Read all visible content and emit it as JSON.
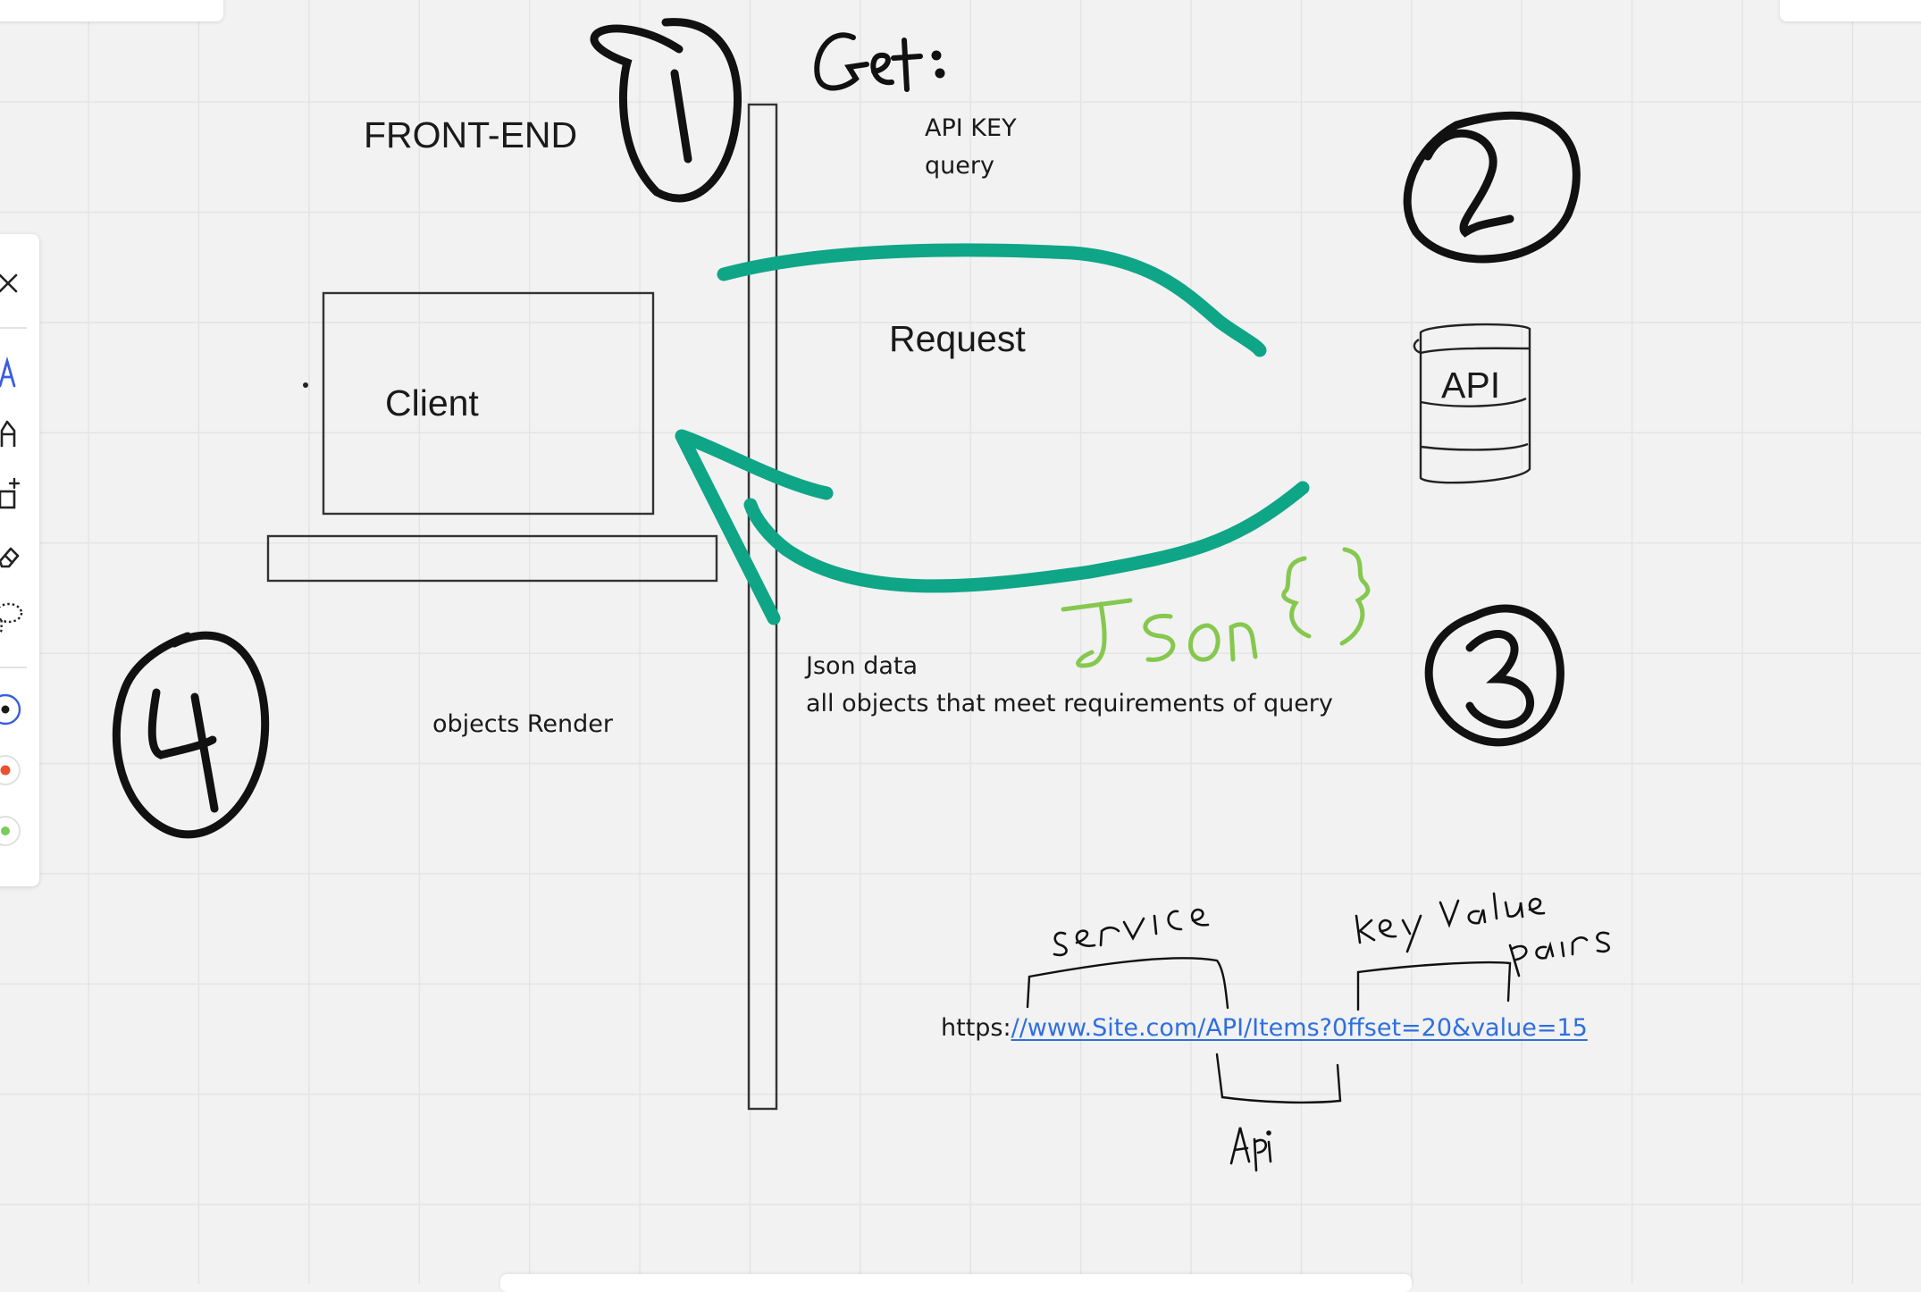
{
  "board": {
    "front_end_label": "FRONT-END",
    "client_label": "Client",
    "request_label": "Request",
    "api_label": "API",
    "get_notes": {
      "line1": "API KEY",
      "line2": "query"
    },
    "json_notes": {
      "line1": "Json data",
      "line2": "all objects that meet requirements of query"
    },
    "objects_render_label": "objects Render",
    "url": {
      "prefix": "https:",
      "link": "//www.Site.com/API/Items?0ffset=20&value=15"
    }
  },
  "handwriting": {
    "get": "Get:",
    "json": "Json {}",
    "service": "service",
    "key_value": "key value",
    "pairs": "pairs",
    "api_lower": "Api",
    "step_numbers": [
      "1",
      "2",
      "3",
      "4"
    ]
  },
  "toolbar": {
    "tools": [
      "close-icon",
      "pen-icon",
      "highlighter-icon",
      "shape-plus-icon",
      "eraser-icon",
      "lasso-icon"
    ],
    "colors": [
      "#1a1a1a",
      "#e8522f",
      "#7cc95c"
    ],
    "selected_color": "#1a1a1a"
  },
  "colors": {
    "arrow": "#0fa587",
    "json_ink": "#86c84f",
    "ink": "#111111",
    "link": "#2f6fde"
  }
}
